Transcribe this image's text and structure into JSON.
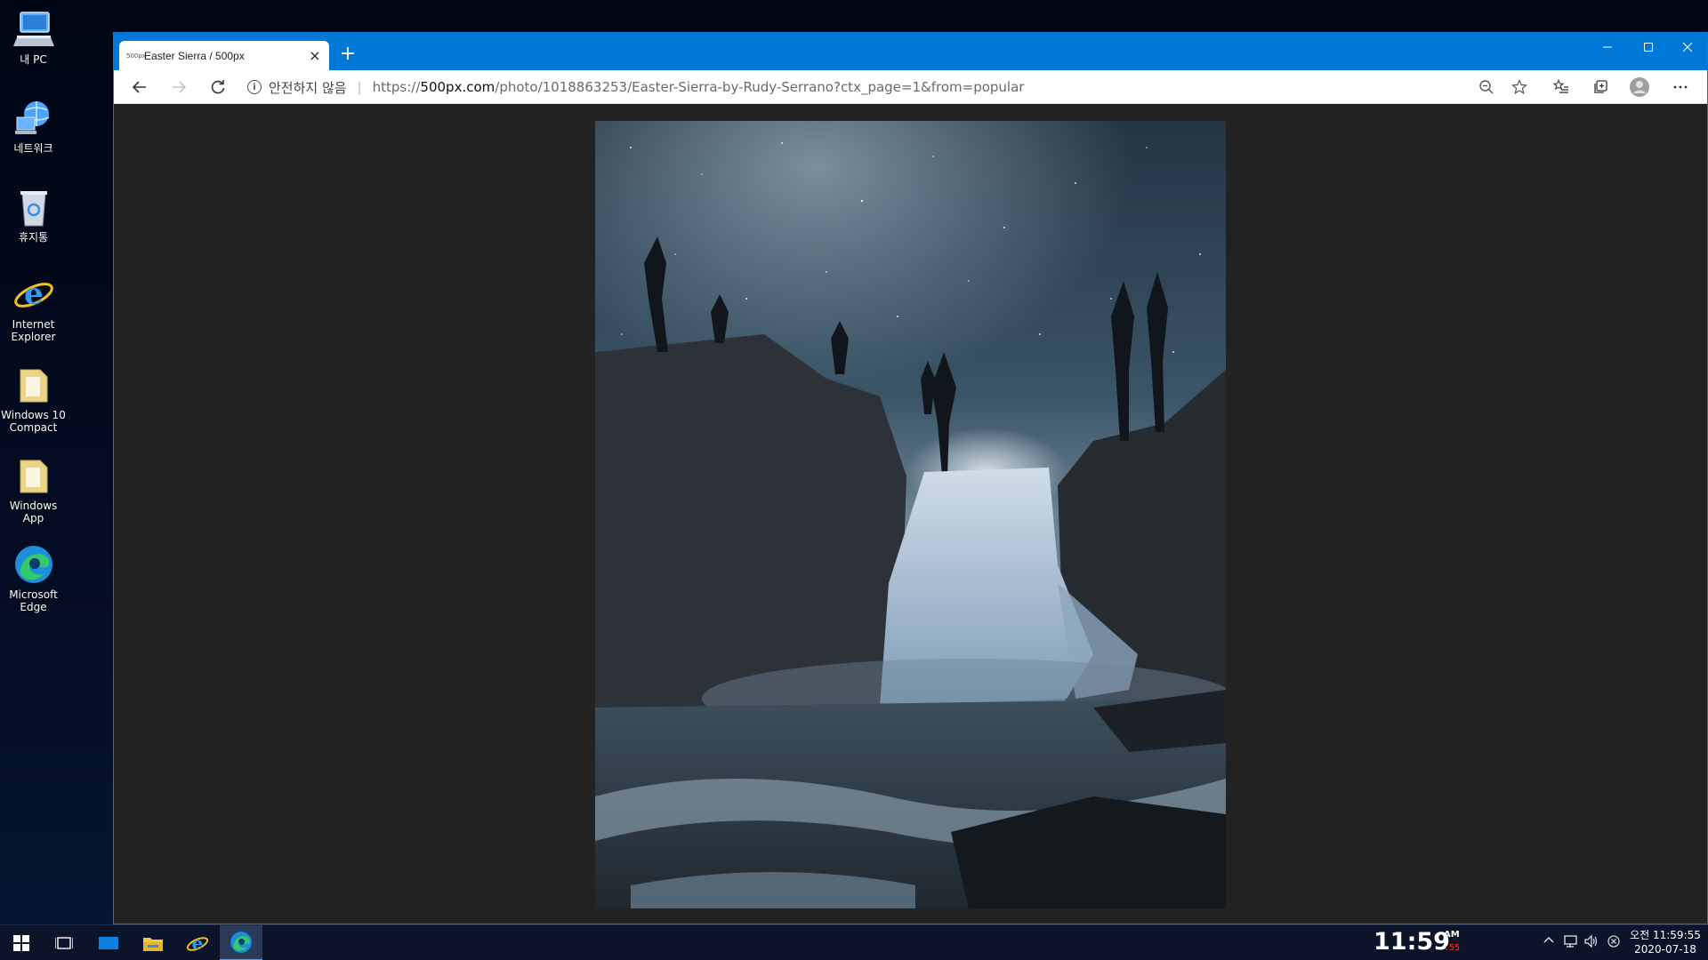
{
  "desktop": {
    "icons": [
      {
        "label": "내 PC",
        "icon": "computer-icon"
      },
      {
        "label": "네트워크",
        "icon": "network-icon"
      },
      {
        "label": "휴지통",
        "icon": "recycle-bin-icon"
      },
      {
        "label": "Internet Explorer",
        "icon": "internet-explorer-icon"
      },
      {
        "label": "Windows 10 Compact",
        "icon": "folder-icon"
      },
      {
        "label": "Windows App",
        "icon": "folder-icon"
      },
      {
        "label": "Microsoft Edge",
        "icon": "edge-icon"
      }
    ]
  },
  "browser": {
    "tab": {
      "favicon_text": "500px",
      "title": "Easter Sierra / 500px",
      "close": "×"
    },
    "new_tab": "+",
    "window_controls": {
      "minimize": "—",
      "maximize": "☐",
      "close": "✕"
    },
    "address": {
      "security_label": "안전하지 않음",
      "url_scheme": "https://",
      "url_host": "500px.com",
      "url_path": "/photo/1018863253/Easter-Sierra-by-Rudy-Serrano?ctx_page=1&from=popular"
    },
    "content_bg": "#222222"
  },
  "taskbar": {
    "clock_big": "11:59",
    "clock_ampm": "AM",
    "clock_seconds": ":55",
    "tray_time": "오전 11:59:55",
    "tray_date": "2020-07-18",
    "accent": "#0078d7"
  }
}
